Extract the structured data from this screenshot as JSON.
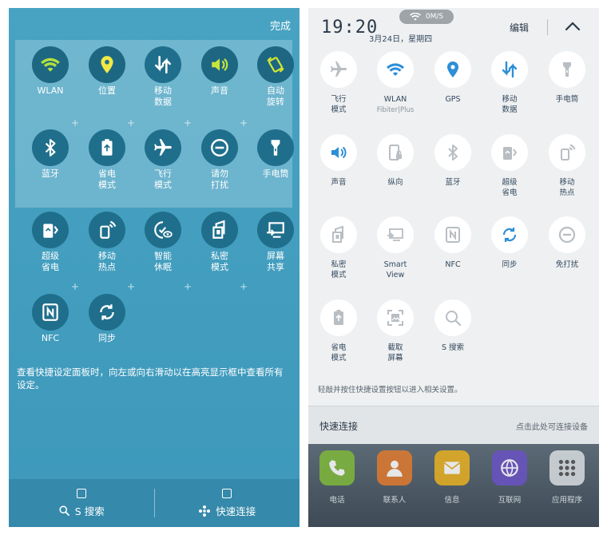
{
  "left": {
    "done": "完成",
    "tiles": [
      {
        "label": "WLAN",
        "icon": "wifi-icon"
      },
      {
        "label": "位置",
        "icon": "location-icon"
      },
      {
        "label": "移动\n数据",
        "icon": "mobile-data-icon"
      },
      {
        "label": "声音",
        "icon": "sound-icon"
      },
      {
        "label": "自动\n旋转",
        "icon": "auto-rotate-icon"
      },
      {
        "label": "蓝牙",
        "icon": "bluetooth-icon"
      },
      {
        "label": "省电\n模式",
        "icon": "power-saving-icon"
      },
      {
        "label": "飞行\n模式",
        "icon": "airplane-icon"
      },
      {
        "label": "请勿\n打扰",
        "icon": "do-not-disturb-icon"
      },
      {
        "label": "手电筒",
        "icon": "flashlight-icon"
      },
      {
        "label": "超级\n省电",
        "icon": "ultra-power-saving-icon"
      },
      {
        "label": "移动\n热点",
        "icon": "hotspot-icon"
      },
      {
        "label": "智能\n休眠",
        "icon": "smart-stay-icon"
      },
      {
        "label": "私密\n模式",
        "icon": "private-mode-icon"
      },
      {
        "label": "屏幕\n共享",
        "icon": "screen-share-icon"
      },
      {
        "label": "NFC",
        "icon": "nfc-icon"
      },
      {
        "label": "同步",
        "icon": "sync-icon"
      }
    ],
    "hint": "查看快捷设定面板时，向左或向右滑动以在高亮显示框中查看所有设定。",
    "bottom": {
      "search": "S 搜索",
      "quick_connect": "快速连接"
    }
  },
  "right": {
    "time": "19:20",
    "date": "3月24日，星期四",
    "speed": "0M/S",
    "edit": "编辑",
    "tiles": [
      {
        "label": "飞行\n模式",
        "icon": "airplane-icon"
      },
      {
        "label": "WLAN",
        "sub": "Fibiter|Plus",
        "icon": "wifi-icon"
      },
      {
        "label": "GPS",
        "icon": "location-icon"
      },
      {
        "label": "移动\n数据",
        "icon": "mobile-data-icon"
      },
      {
        "label": "手电筒",
        "icon": "flashlight-icon"
      },
      {
        "label": "声音",
        "icon": "sound-icon"
      },
      {
        "label": "纵向",
        "icon": "portrait-lock-icon"
      },
      {
        "label": "蓝牙",
        "icon": "bluetooth-icon"
      },
      {
        "label": "超级\n省电",
        "icon": "ultra-power-saving-icon"
      },
      {
        "label": "移动\n热点",
        "icon": "hotspot-icon"
      },
      {
        "label": "私密\n模式",
        "icon": "private-mode-icon"
      },
      {
        "label": "Smart\nView",
        "icon": "smart-view-icon"
      },
      {
        "label": "NFC",
        "icon": "nfc-icon"
      },
      {
        "label": "同步",
        "icon": "sync-icon"
      },
      {
        "label": "免打扰",
        "icon": "do-not-disturb-icon"
      },
      {
        "label": "省电\n模式",
        "icon": "power-saving-icon"
      },
      {
        "label": "截取\n屏幕",
        "icon": "screenshot-icon"
      },
      {
        "label": "S 搜索",
        "icon": "search-icon"
      }
    ],
    "hint": "轻敲并按住快捷设置按钮以进入相关设置。",
    "quick": {
      "title": "快速连接",
      "action": "点击此处可连接设备"
    },
    "dock": [
      {
        "label": "电话",
        "icon": "phone-icon",
        "color": "#7fb83a"
      },
      {
        "label": "联系人",
        "icon": "contacts-icon",
        "color": "#e07a2e"
      },
      {
        "label": "信息",
        "icon": "messages-icon",
        "color": "#e8b020"
      },
      {
        "label": "互联网",
        "icon": "internet-icon",
        "color": "#6a52c4"
      },
      {
        "label": "应用程序",
        "icon": "apps-icon",
        "color": "#d8dde0"
      }
    ]
  }
}
